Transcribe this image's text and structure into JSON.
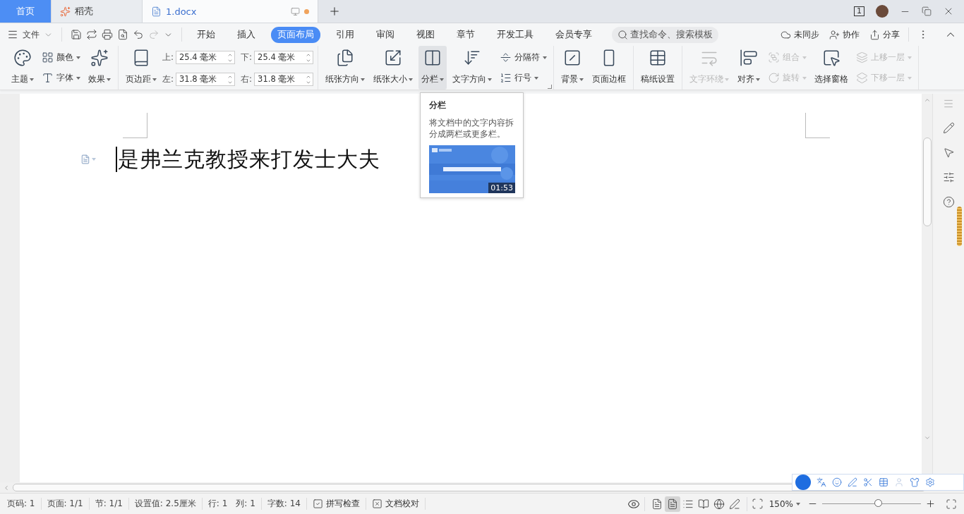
{
  "tabs": [
    {
      "label": "首页",
      "kind": "home",
      "selected": false,
      "modified": false
    },
    {
      "label": "稻壳",
      "kind": "app",
      "selected": false,
      "modified": false
    },
    {
      "label": "1.docx",
      "kind": "document",
      "selected": true,
      "modified": true
    }
  ],
  "window_count": "1",
  "file_menu": "文件",
  "ribbon_tabs": [
    {
      "label": "开始",
      "selected": false
    },
    {
      "label": "插入",
      "selected": false
    },
    {
      "label": "页面布局",
      "selected": true
    },
    {
      "label": "引用",
      "selected": false
    },
    {
      "label": "审阅",
      "selected": false
    },
    {
      "label": "视图",
      "selected": false
    },
    {
      "label": "章节",
      "selected": false
    },
    {
      "label": "开发工具",
      "selected": false
    },
    {
      "label": "会员专享",
      "selected": false
    }
  ],
  "search": {
    "placeholder": "查找命令、搜索模板"
  },
  "actions": [
    "未同步",
    "协作",
    "分享"
  ],
  "ribbon_groups": [
    {
      "items": [
        {
          "kind": "big",
          "label": "主题",
          "caret": true,
          "disabled": false,
          "hovered": false
        },
        {
          "kind": "stack",
          "items": [
            {
              "label": "颜色",
              "caret": true,
              "disabled": false
            },
            {
              "label": "字体",
              "caret": true,
              "disabled": false
            }
          ]
        },
        {
          "kind": "big",
          "label": "效果",
          "caret": true,
          "disabled": false,
          "hovered": false
        }
      ]
    },
    {
      "items": [
        {
          "kind": "big",
          "label": "页边距",
          "caret": true,
          "disabled": false,
          "hovered": false
        },
        {
          "kind": "spins",
          "fields": [
            {
              "label": "上:",
              "value": "25.4 毫米"
            },
            {
              "label": "左:",
              "value": "31.8 毫米"
            },
            {
              "label": "下:",
              "value": "25.4 毫米"
            },
            {
              "label": "右:",
              "value": "31.8 毫米"
            }
          ]
        }
      ]
    },
    {
      "items": [
        {
          "kind": "big",
          "label": "纸张方向",
          "caret": true,
          "disabled": false,
          "hovered": false
        },
        {
          "kind": "big",
          "label": "纸张大小",
          "caret": true,
          "disabled": false,
          "hovered": false
        },
        {
          "kind": "big",
          "label": "分栏",
          "caret": true,
          "disabled": false,
          "hovered": true
        },
        {
          "kind": "big",
          "label": "文字方向",
          "caret": true,
          "disabled": false,
          "hovered": false
        },
        {
          "kind": "stack",
          "items": [
            {
              "label": "分隔符",
              "caret": true,
              "disabled": false
            },
            {
              "label": "行号",
              "caret": true,
              "disabled": false
            }
          ]
        }
      ]
    },
    {
      "items": [
        {
          "kind": "big",
          "label": "背景",
          "caret": true,
          "disabled": false,
          "hovered": false
        },
        {
          "kind": "big",
          "label": "页面边框",
          "caret": false,
          "disabled": false,
          "hovered": false
        }
      ]
    },
    {
      "items": [
        {
          "kind": "big",
          "label": "稿纸设置",
          "caret": false,
          "disabled": false,
          "hovered": false
        }
      ]
    },
    {
      "items": [
        {
          "kind": "big",
          "label": "文字环绕",
          "caret": true,
          "disabled": true,
          "hovered": false
        },
        {
          "kind": "big",
          "label": "对齐",
          "caret": true,
          "disabled": false,
          "hovered": false
        },
        {
          "kind": "stack",
          "items": [
            {
              "label": "组合",
              "caret": true,
              "disabled": true
            },
            {
              "label": "旋转",
              "caret": true,
              "disabled": true
            }
          ]
        },
        {
          "kind": "big",
          "label": "选择窗格",
          "caret": false,
          "disabled": false,
          "hovered": false
        },
        {
          "kind": "stack",
          "items": [
            {
              "label": "上移一层",
              "caret": true,
              "disabled": true
            },
            {
              "label": "下移一层",
              "caret": true,
              "disabled": true
            }
          ]
        }
      ]
    }
  ],
  "document": {
    "paragraph": "是弗兰克教授来打发士大夫"
  },
  "tooltip": {
    "title": "分栏",
    "text": "将文档中的文字内容拆分成两栏或更多栏。",
    "video": {
      "kind": "picture",
      "duration": "01:53"
    }
  },
  "status": {
    "cells": [
      [
        "页码: 1"
      ],
      [
        "页面: 1/1"
      ],
      [
        "节: 1/1"
      ],
      [
        "设置值: 2.5厘米"
      ],
      [
        "行: 1",
        "列: 1"
      ],
      [
        "字数: 14"
      ]
    ],
    "checks": [
      "拼写检查",
      "文档校对"
    ],
    "view_modes": [
      {
        "selected": false
      },
      {
        "selected": true
      },
      {
        "selected": false
      },
      {
        "selected": false
      },
      {
        "selected": false
      },
      {
        "selected": false
      }
    ],
    "zoom": {
      "value": "150%",
      "level": 0.57
    }
  }
}
